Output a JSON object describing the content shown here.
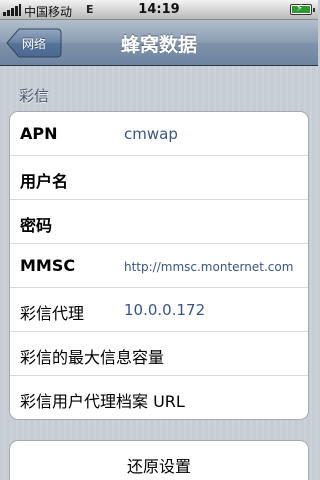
{
  "status_bar": {
    "carrier": "中国移动",
    "network": "E",
    "time": "14:19"
  },
  "nav": {
    "back_label": "网络",
    "title": "蜂窝数据"
  },
  "section": {
    "header": "彩信"
  },
  "rows": [
    {
      "label": "APN",
      "value": "cmwap"
    },
    {
      "label": "用户名",
      "value": ""
    },
    {
      "label": "密码",
      "value": ""
    },
    {
      "label": "MMSC",
      "value": "http://mmsc.monternet.com"
    },
    {
      "label": "彩信代理",
      "value": "10.0.0.172"
    },
    {
      "label": "彩信的最大信息容量",
      "value": ""
    },
    {
      "label": "彩信用户代理档案 URL",
      "value": ""
    }
  ],
  "reset": {
    "label": "还原设置"
  },
  "colors": {
    "value_text": "#385487",
    "nav_bar": "#7f92a8",
    "background": "#c5ccd4"
  }
}
